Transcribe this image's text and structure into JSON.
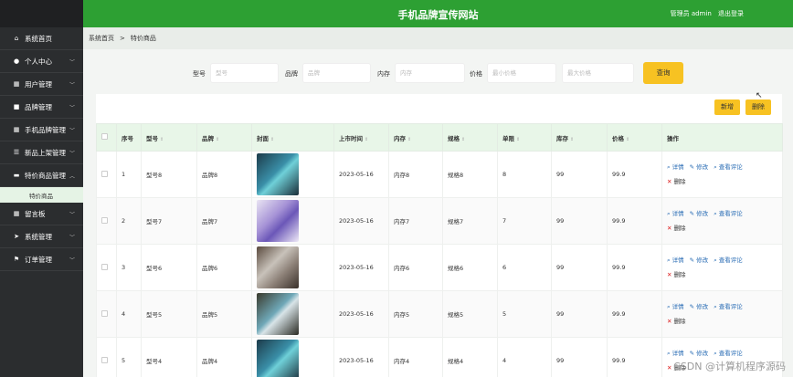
{
  "header": {
    "title": "手机品牌宣传网站",
    "user": "管理员 admin",
    "logout": "退出登录"
  },
  "sidebar": {
    "items": [
      {
        "label": "系统首页",
        "icon": "home-icon",
        "glyph": "⌂",
        "chevron": false
      },
      {
        "label": "个人中心",
        "icon": "user-icon",
        "glyph": "●",
        "chevron": true
      },
      {
        "label": "用户管理",
        "icon": "grid-icon",
        "glyph": "▦",
        "chevron": true
      },
      {
        "label": "品牌管理",
        "icon": "box-icon",
        "glyph": "■",
        "chevron": true
      },
      {
        "label": "手机品牌管理",
        "icon": "grid-icon",
        "glyph": "▦",
        "chevron": true
      },
      {
        "label": "新品上架管理",
        "icon": "sliders-icon",
        "glyph": "☰",
        "chevron": true
      },
      {
        "label": "特价商品管理",
        "icon": "comment-icon",
        "glyph": "▬",
        "chevron": true,
        "expanded": true
      }
    ],
    "sub_item": "特价商品",
    "items2": [
      {
        "label": "留言板",
        "icon": "grid-icon",
        "glyph": "▦",
        "chevron": true
      },
      {
        "label": "系统管理",
        "icon": "send-icon",
        "glyph": "➤",
        "chevron": true
      },
      {
        "label": "订单管理",
        "icon": "flag-icon",
        "glyph": "⚑",
        "chevron": true
      }
    ]
  },
  "breadcrumb": {
    "home": "系统首页",
    "sep": ">",
    "current": "特价商品"
  },
  "search": {
    "model_label": "型号",
    "model_placeholder": "型号",
    "brand_label": "品牌",
    "brand_placeholder": "品牌",
    "memory_label": "内存",
    "memory_placeholder": "内存",
    "price_label": "价格",
    "min_placeholder": "最小价格",
    "max_placeholder": "最大价格",
    "query": "查询"
  },
  "toolbar": {
    "add": "新增",
    "delete": "删除"
  },
  "table": {
    "headers": [
      "",
      "序号",
      "型号",
      "品牌",
      "封面",
      "上市时间",
      "内存",
      "规格",
      "单限",
      "库存",
      "价格",
      "操作"
    ],
    "rows": [
      {
        "no": "1",
        "model": "型号8",
        "brand": "品牌8",
        "date": "2023-05-16",
        "memory": "内存8",
        "spec": "规格8",
        "limit": "8",
        "stock": "99",
        "price": "99.9"
      },
      {
        "no": "2",
        "model": "型号7",
        "brand": "品牌7",
        "date": "2023-05-16",
        "memory": "内存7",
        "spec": "规格7",
        "limit": "7",
        "stock": "99",
        "price": "99.9"
      },
      {
        "no": "3",
        "model": "型号6",
        "brand": "品牌6",
        "date": "2023-05-16",
        "memory": "内存6",
        "spec": "规格6",
        "limit": "6",
        "stock": "99",
        "price": "99.9"
      },
      {
        "no": "4",
        "model": "型号5",
        "brand": "品牌5",
        "date": "2023-05-16",
        "memory": "内存5",
        "spec": "规格5",
        "limit": "5",
        "stock": "99",
        "price": "99.9"
      },
      {
        "no": "5",
        "model": "型号4",
        "brand": "品牌4",
        "date": "2023-05-16",
        "memory": "内存4",
        "spec": "规格4",
        "limit": "4",
        "stock": "99",
        "price": "99.9"
      }
    ],
    "ops": {
      "detail": "详情",
      "edit": "修改",
      "reviews": "查看评论",
      "delete": "删除"
    }
  },
  "watermark": "CSDN @计算机程序源码",
  "colors": {
    "header": "#2da033",
    "sidebar": "#2b2d2f",
    "accent": "#f7c222",
    "link": "#2a6db5"
  }
}
